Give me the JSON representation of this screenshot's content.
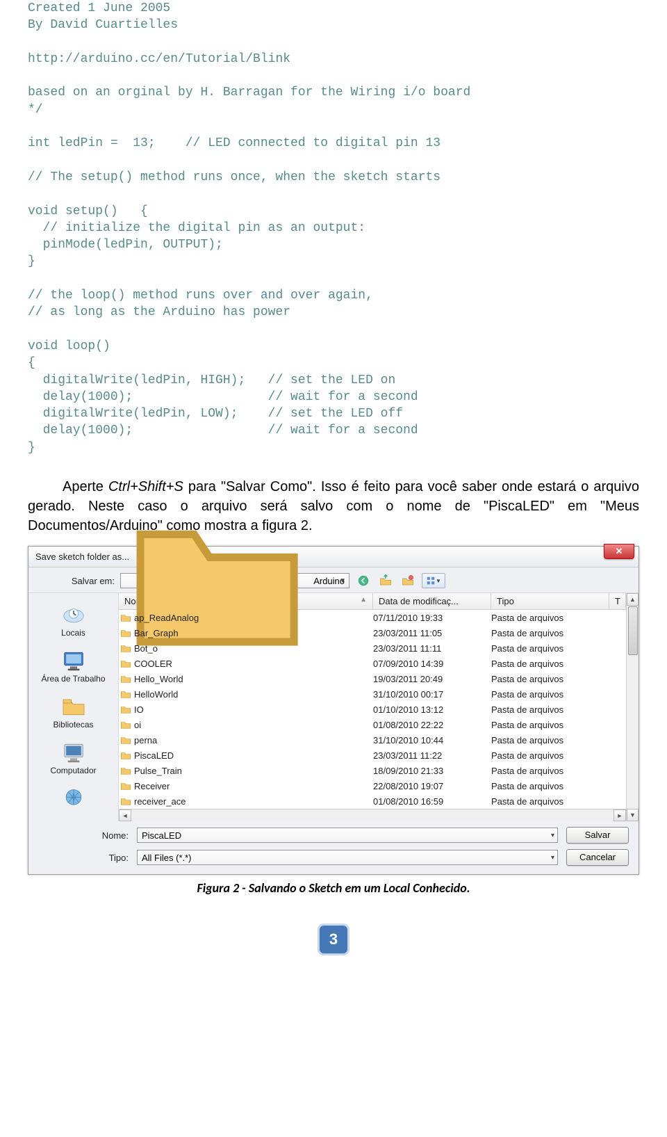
{
  "code": {
    "l1": "Created 1 June 2005",
    "l2": "By David Cuartielles",
    "l3": "",
    "l4": "http://arduino.cc/en/Tutorial/Blink",
    "l5": "",
    "l6": "based on an orginal by H. Barragan for the Wiring i/o board",
    "l7": "*/",
    "l8": "",
    "l9": "int ledPin =  13;    // LED connected to digital pin 13",
    "l10": "",
    "l11": "// The setup() method runs once, when the sketch starts",
    "l12": "",
    "l13": "void setup()   {",
    "l14": "  // initialize the digital pin as an output:",
    "l15": "  pinMode(ledPin, OUTPUT);",
    "l16": "}",
    "l17": "",
    "l18": "// the loop() method runs over and over again,",
    "l19": "// as long as the Arduino has power",
    "l20": "",
    "l21": "void loop()",
    "l22": "{",
    "l23": "  digitalWrite(ledPin, HIGH);   // set the LED on",
    "l24": "  delay(1000);                  // wait for a second",
    "l25": "  digitalWrite(ledPin, LOW);    // set the LED off",
    "l26": "  delay(1000);                  // wait for a second",
    "l27": "}"
  },
  "para": {
    "p1a": "Aperte ",
    "p1b": "Ctrl+Shift+S",
    "p1c": " para \"Salvar Como\". Isso é feito para você saber onde estará o arquivo gerado. Neste caso o arquivo será salvo com o nome de \"PiscaLED\" em \"Meus Documentos/Arduino\" como mostra a figura 2."
  },
  "dialog": {
    "title": "Save sketch folder as...",
    "savein_label": "Salvar em:",
    "savein_value": "Arduino",
    "cols": {
      "name": "Nome",
      "date": "Data de modificaç...",
      "type": "Tipo",
      "t": "T"
    },
    "places": {
      "recent": "Locais",
      "desktop": "Área de Trabalho",
      "libs": "Bibliotecas",
      "computer": "Computador"
    },
    "files": [
      {
        "name": "ap_ReadAnalog",
        "date": "07/11/2010 19:33",
        "type": "Pasta de arquivos"
      },
      {
        "name": "Bar_Graph",
        "date": "23/03/2011 11:05",
        "type": "Pasta de arquivos"
      },
      {
        "name": "Bot_o",
        "date": "23/03/2011 11:11",
        "type": "Pasta de arquivos"
      },
      {
        "name": "COOLER",
        "date": "07/09/2010 14:39",
        "type": "Pasta de arquivos"
      },
      {
        "name": "Hello_World",
        "date": "19/03/2011 20:49",
        "type": "Pasta de arquivos"
      },
      {
        "name": "HelloWorld",
        "date": "31/10/2010 00:17",
        "type": "Pasta de arquivos"
      },
      {
        "name": "IO",
        "date": "01/10/2010 13:12",
        "type": "Pasta de arquivos"
      },
      {
        "name": "oi",
        "date": "01/08/2010 22:22",
        "type": "Pasta de arquivos"
      },
      {
        "name": "perna",
        "date": "31/10/2010 10:44",
        "type": "Pasta de arquivos"
      },
      {
        "name": "PiscaLED",
        "date": "23/03/2011 11:22",
        "type": "Pasta de arquivos"
      },
      {
        "name": "Pulse_Train",
        "date": "18/09/2010 21:33",
        "type": "Pasta de arquivos"
      },
      {
        "name": "Receiver",
        "date": "22/08/2010 19:07",
        "type": "Pasta de arquivos"
      },
      {
        "name": "receiver_ace",
        "date": "01/08/2010 16:59",
        "type": "Pasta de arquivos"
      }
    ],
    "name_label": "Nome:",
    "name_value": "PiscaLED",
    "type_label": "Tipo:",
    "type_value": "All Files (*.*)",
    "save_btn": "Salvar",
    "cancel_btn": "Cancelar"
  },
  "caption": "Figura 2 - Salvando o Sketch em um Local Conhecido.",
  "page": "3"
}
